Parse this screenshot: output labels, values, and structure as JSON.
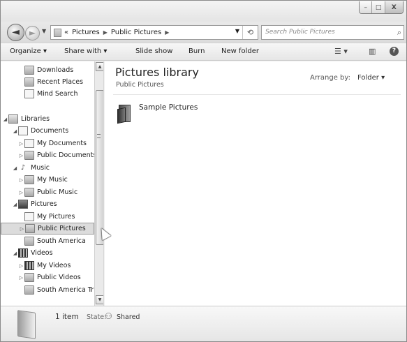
{
  "window": {
    "caption_buttons": [
      {
        "name": "minimize-button",
        "glyph": "–"
      },
      {
        "name": "maximize-button",
        "glyph": "□"
      },
      {
        "name": "close-button",
        "glyph": "X"
      }
    ]
  },
  "nav": {
    "back_glyph": "◄",
    "forward_glyph": "►",
    "history_dropdown_glyph": "▼",
    "address": {
      "overflow": "«",
      "crumbs": [
        "Pictures",
        "Public Pictures"
      ],
      "separator": "▶",
      "dropdown_glyph": "▼",
      "refresh_glyph": "⟲"
    },
    "search": {
      "placeholder": "Search Public Pictures",
      "icon_glyph": "⌕"
    }
  },
  "toolbar": {
    "organize": "Organize ▾",
    "share_with": "Share with ▾",
    "slide_show": "Slide show",
    "burn": "Burn",
    "new_folder": "New folder",
    "view_icon": "☰ ▾",
    "preview_icon": "▥",
    "help_icon": "?"
  },
  "navpane": {
    "items": [
      {
        "label": "Downloads",
        "icon": "folder",
        "level": 1,
        "arrow": ""
      },
      {
        "label": "Recent Places",
        "icon": "folder",
        "level": 1,
        "arrow": ""
      },
      {
        "label": "Mind Search",
        "icon": "doc",
        "level": 1,
        "arrow": ""
      },
      {
        "label": "Libraries",
        "icon": "lib",
        "level": 0,
        "arrow": "◢"
      },
      {
        "label": "Documents",
        "icon": "doc",
        "level": 1,
        "arrow": "◢"
      },
      {
        "label": "My Documents",
        "icon": "doc",
        "level": 2,
        "arrow": "▷"
      },
      {
        "label": "Public Documents",
        "icon": "folder",
        "level": 2,
        "arrow": "▷"
      },
      {
        "label": "Music",
        "icon": "music",
        "level": 1,
        "arrow": "◢"
      },
      {
        "label": "My Music",
        "icon": "folder",
        "level": 2,
        "arrow": "▷"
      },
      {
        "label": "Public Music",
        "icon": "folder",
        "level": 2,
        "arrow": "▷"
      },
      {
        "label": "Pictures",
        "icon": "pic",
        "level": 1,
        "arrow": "◢"
      },
      {
        "label": "My Pictures",
        "icon": "doc",
        "level": 2,
        "arrow": ""
      },
      {
        "label": "Public Pictures",
        "icon": "folder",
        "level": 2,
        "arrow": "▷",
        "selected": true
      },
      {
        "label": "South America",
        "icon": "folder",
        "level": 2,
        "arrow": ""
      },
      {
        "label": "Videos",
        "icon": "vid",
        "level": 1,
        "arrow": "◢"
      },
      {
        "label": "My Videos",
        "icon": "vid",
        "level": 2,
        "arrow": "▷"
      },
      {
        "label": "Public Videos",
        "icon": "folder",
        "level": 2,
        "arrow": "▷"
      },
      {
        "label": "South America Trip",
        "icon": "folder",
        "level": 2,
        "arrow": ""
      }
    ]
  },
  "scrollbar": {
    "up_glyph": "▲",
    "down_glyph": "▼"
  },
  "content": {
    "title": "Pictures library",
    "subtitle": "Public Pictures",
    "arrange_label": "Arrange by:",
    "arrange_value": "Folder ▾",
    "items": [
      {
        "label": "Sample Pictures"
      }
    ]
  },
  "details": {
    "count": "1 item",
    "state_label": "State:",
    "state_icon": "⚇",
    "state_value": "Shared"
  }
}
